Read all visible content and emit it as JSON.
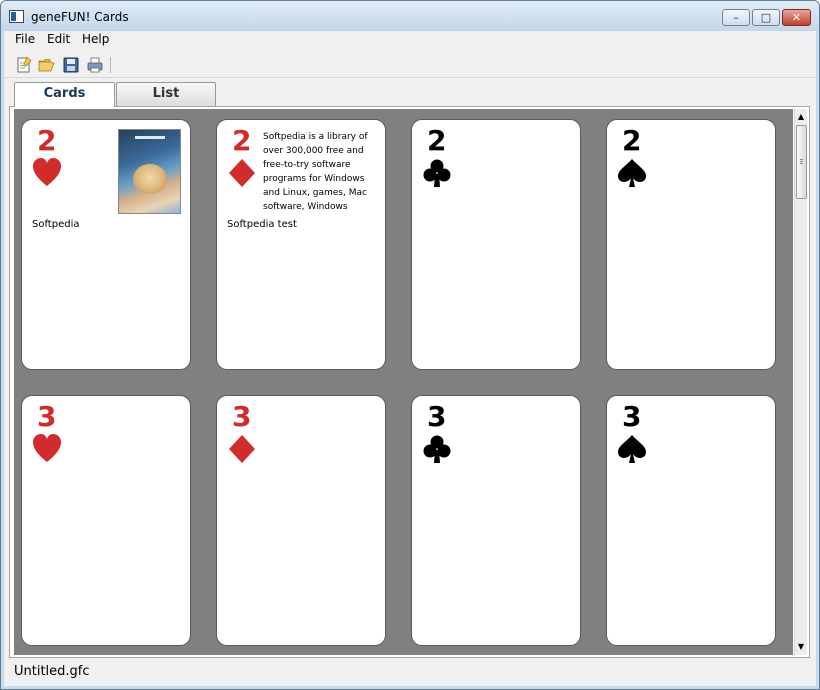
{
  "window": {
    "title": "geneFUN! Cards"
  },
  "titlebar_buttons": {
    "minimize": "–",
    "maximize": "□",
    "close": "✕"
  },
  "menu": {
    "items": [
      "File",
      "Edit",
      "Help"
    ]
  },
  "toolbar": {
    "icons": [
      "new-document-icon",
      "open-folder-icon",
      "save-icon",
      "print-icon"
    ]
  },
  "tabs": [
    {
      "label": "Cards",
      "active": true
    },
    {
      "label": "List",
      "active": false
    }
  ],
  "cards": [
    {
      "rank": "2",
      "suit": "hearts",
      "color": "red",
      "title": "Softpedia",
      "text": "",
      "has_image": true
    },
    {
      "rank": "2",
      "suit": "diamonds",
      "color": "red",
      "title": "Softpedia test",
      "text": "Softpedia is a library of over 300,000 free and free-to-try software programs for Windows and Linux, games, Mac software, Windows",
      "has_image": false
    },
    {
      "rank": "2",
      "suit": "clubs",
      "color": "black",
      "title": "",
      "text": "",
      "has_image": false
    },
    {
      "rank": "2",
      "suit": "spades",
      "color": "black",
      "title": "",
      "text": "",
      "has_image": false
    },
    {
      "rank": "3",
      "suit": "hearts",
      "color": "red",
      "title": "",
      "text": "",
      "has_image": false
    },
    {
      "rank": "3",
      "suit": "diamonds",
      "color": "red",
      "title": "",
      "text": "",
      "has_image": false
    },
    {
      "rank": "3",
      "suit": "clubs",
      "color": "black",
      "title": "",
      "text": "",
      "has_image": false
    },
    {
      "rank": "3",
      "suit": "spades",
      "color": "black",
      "title": "",
      "text": "",
      "has_image": false
    }
  ],
  "colors": {
    "red_suit": "#d22b2b",
    "black_suit": "#000000",
    "card_area_bg": "#808080"
  },
  "status": {
    "filename": "Untitled.gfc"
  }
}
